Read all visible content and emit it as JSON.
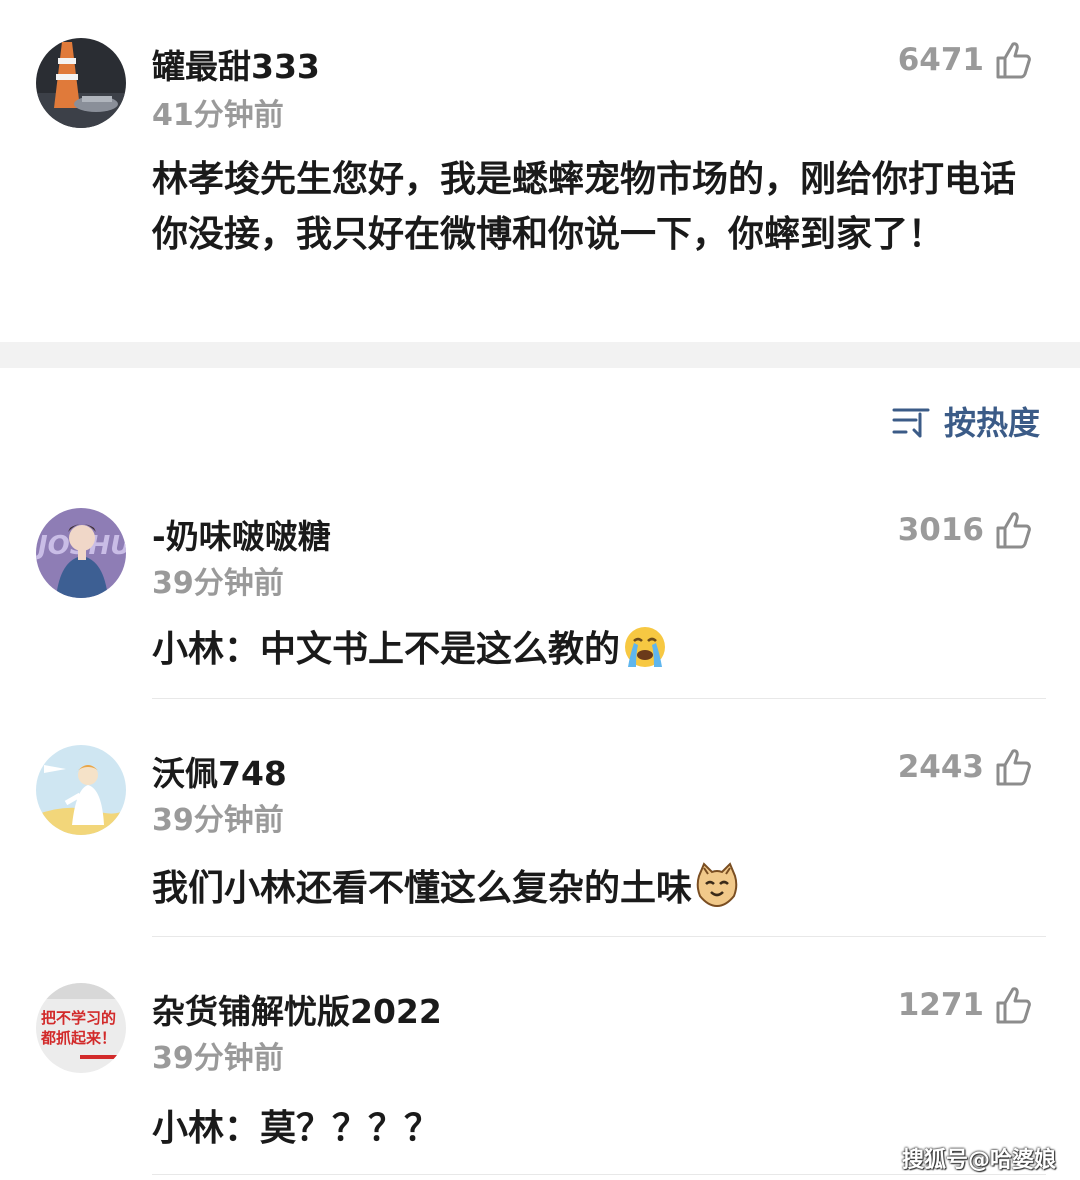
{
  "post": {
    "username": "罐最甜333",
    "time": "41分钟前",
    "likes": "6471",
    "text": "林孝埈先生您好，我是蟋蟀宠物市场的，刚给你打电话你没接，我只好在微博和你说一下，你蟀到家了！"
  },
  "sort": {
    "label": "按热度",
    "icon": "sort-icon"
  },
  "comments": [
    {
      "username": "-奶味啵啵糖",
      "time": "39分钟前",
      "likes": "3016",
      "text": "小林：中文书上不是这么教的",
      "emoji": "crying-face"
    },
    {
      "username": "沃佩748",
      "time": "39分钟前",
      "likes": "2443",
      "text": "我们小林还看不懂这么复杂的土味",
      "emoji": "cat-face"
    },
    {
      "username": "杂货铺解忧版2022",
      "time": "39分钟前",
      "likes": "1271",
      "text": "小林：莫？？？？",
      "emoji": "",
      "avatar_text": "把不学习的都抓起来！"
    }
  ],
  "watermark": "搜狐号@哈婆娘",
  "colors": {
    "accent": "#3b5b87",
    "muted": "#9a9a9a",
    "band": "#f2f2f2"
  }
}
